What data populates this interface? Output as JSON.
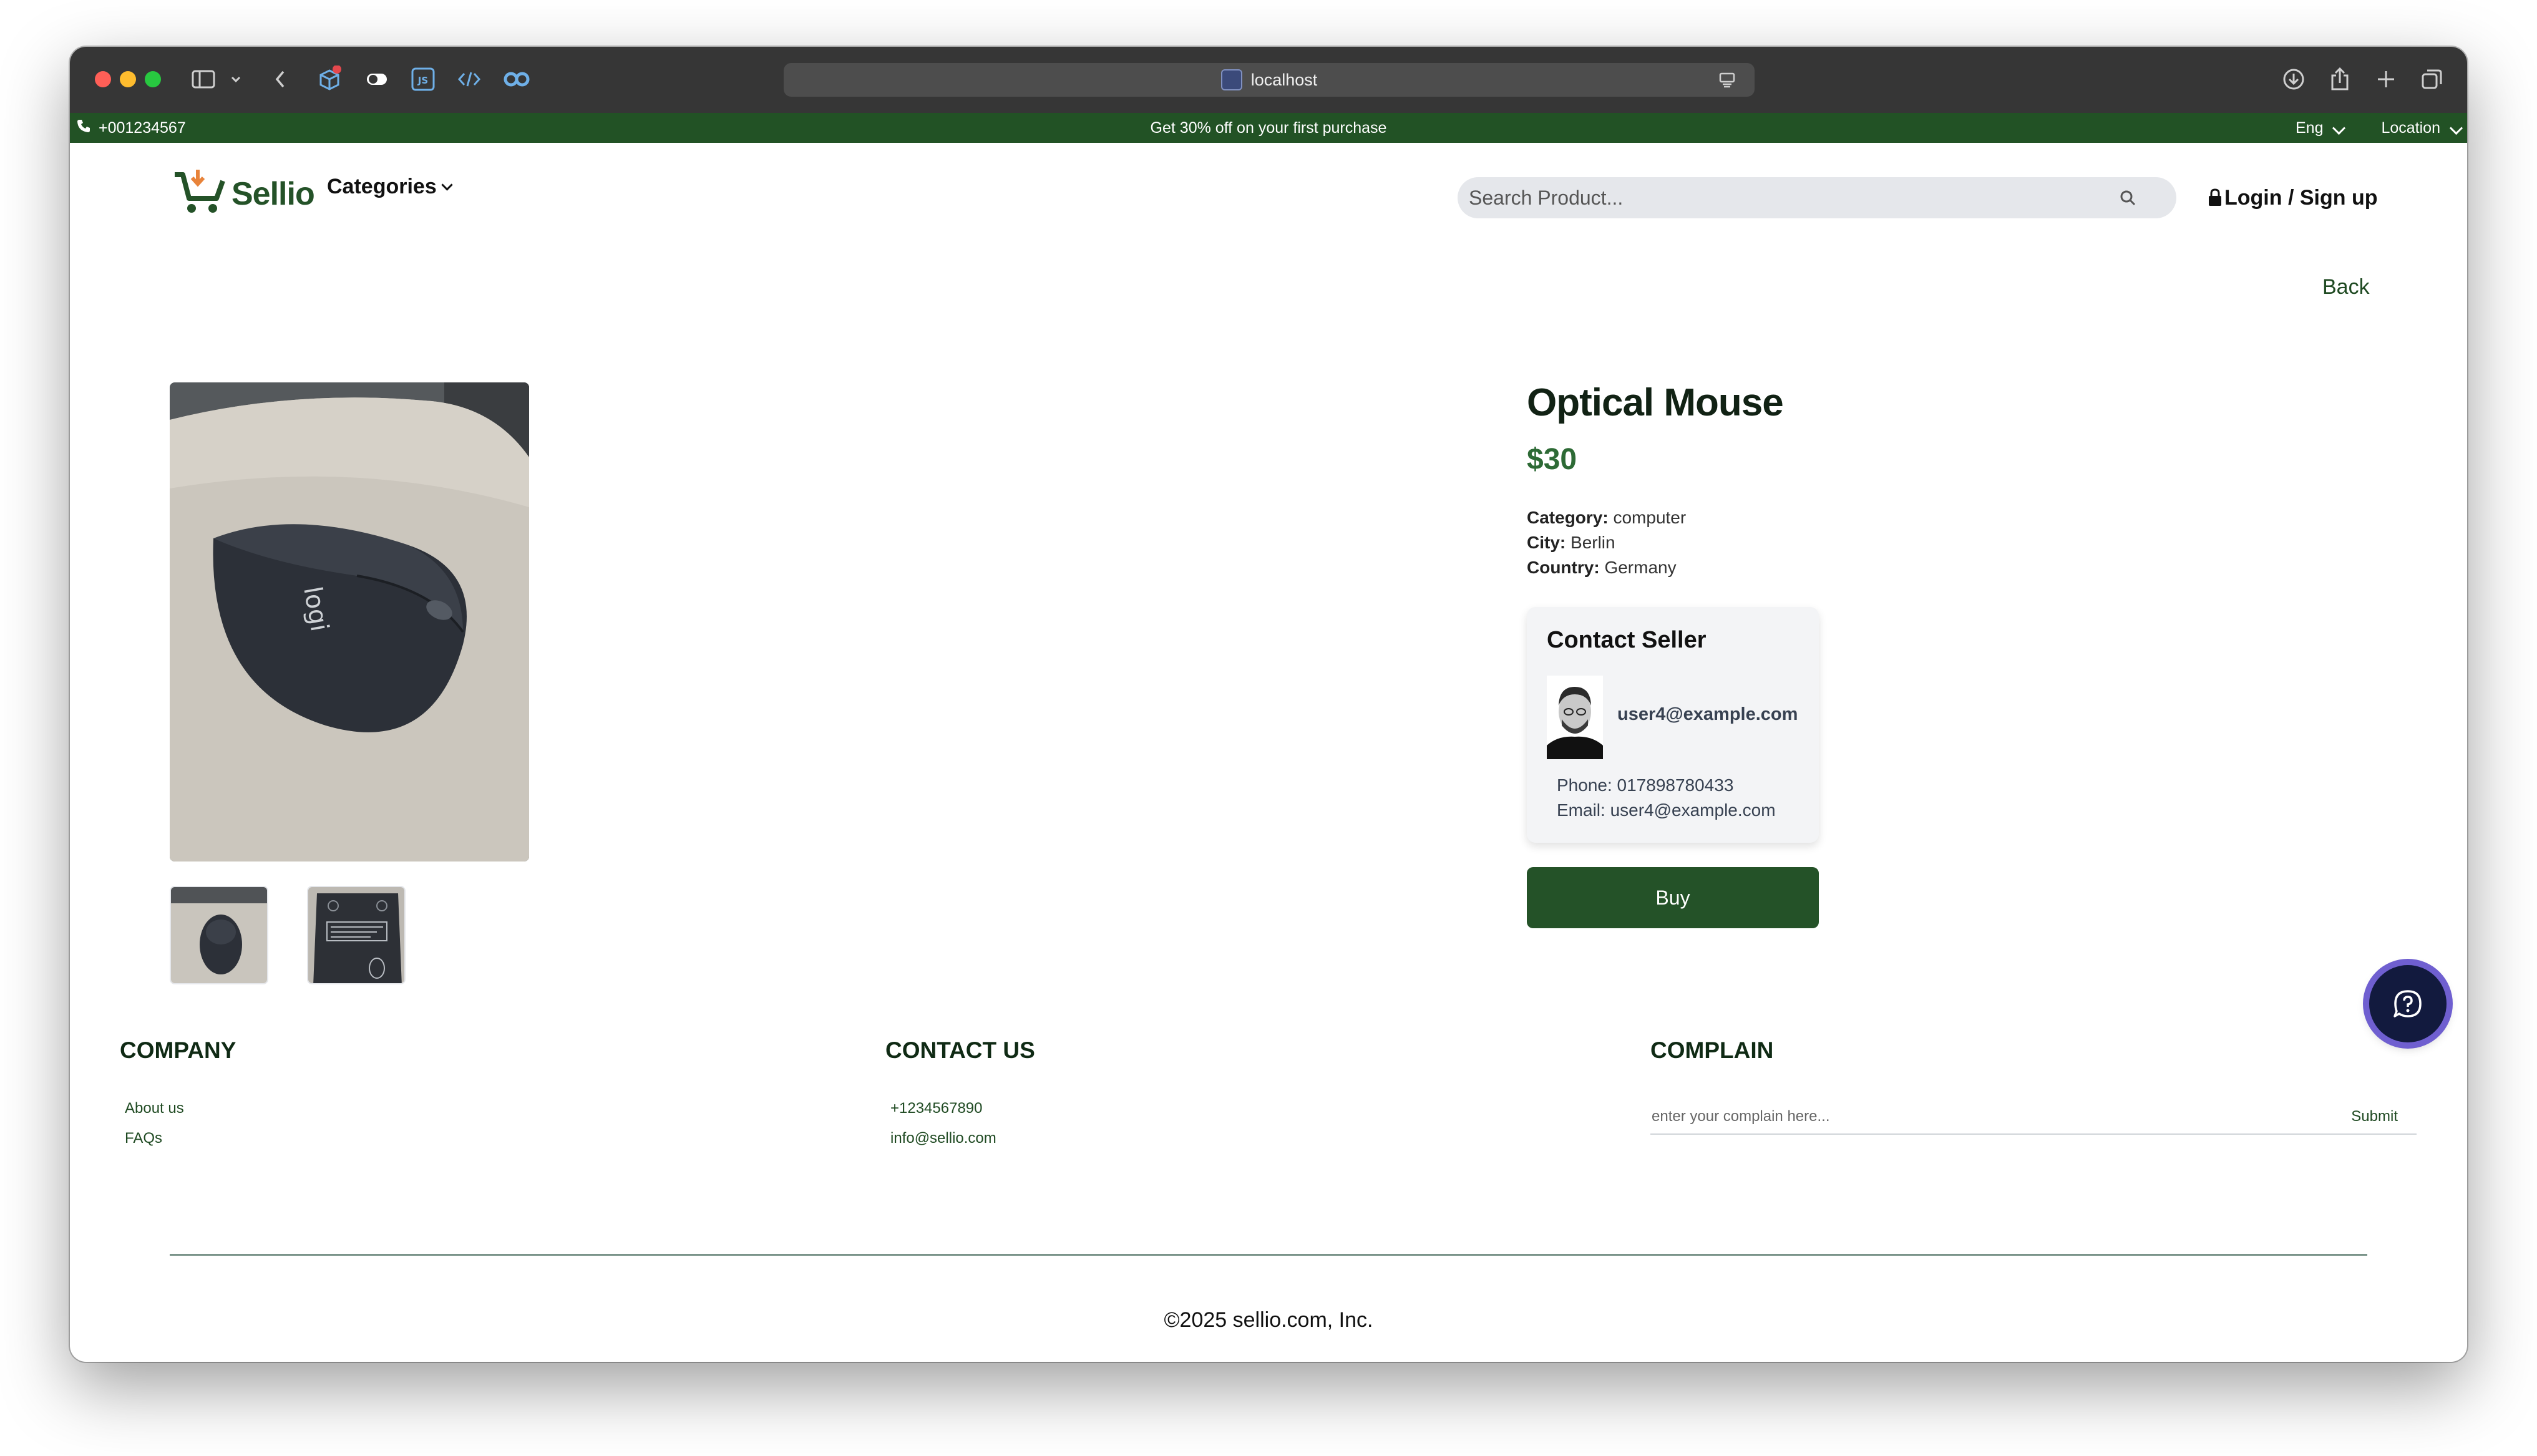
{
  "browser": {
    "url": "localhost",
    "colors": {
      "close": "#ff5f57",
      "minimize": "#febc2e",
      "zoom": "#28c840",
      "toolbar": "#363636"
    }
  },
  "promo_bar": {
    "phone": "+001234567",
    "promo": "Get 30% off on your first purchase",
    "language": "Eng",
    "location": "Location"
  },
  "header": {
    "logo": "Sellio",
    "categories": "Categories",
    "search_placeholder": "Search Product...",
    "login": "Login / Sign up"
  },
  "product": {
    "back": "Back",
    "title": "Optical Mouse",
    "price": "$30",
    "category_label": "Category:",
    "category": "computer",
    "city_label": "City:",
    "city": "Berlin",
    "country_label": "Country:",
    "country": "Germany",
    "image_logo_text": "logi"
  },
  "seller": {
    "heading": "Contact Seller",
    "name": "user4@example.com",
    "phone_line": "Phone: 017898780433",
    "email_line": "Email: user4@example.com"
  },
  "buy_button": "Buy",
  "footer": {
    "company": {
      "heading": "COMPANY",
      "links": [
        "About us",
        "FAQs"
      ]
    },
    "contact": {
      "heading": "CONTACT US",
      "phone": "+1234567890",
      "email": "info@sellio.com"
    },
    "complain": {
      "heading": "COMPLAIN",
      "placeholder": "enter your complain here...",
      "submit": "Submit"
    },
    "copyright": "©2025 sellio.com, Inc."
  },
  "theme": {
    "brand_green": "#245228",
    "accent_orange": "#e8833a",
    "chat_ring": "#6f5fd0"
  }
}
